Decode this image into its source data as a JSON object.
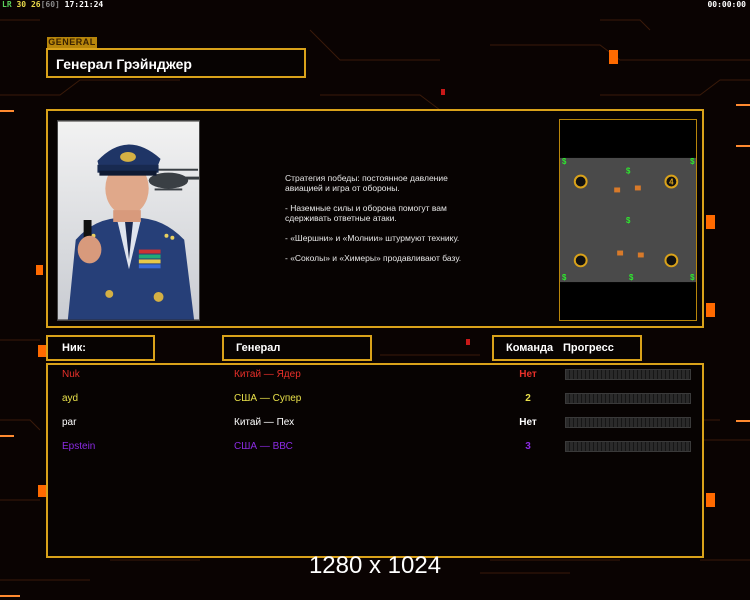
{
  "hud": {
    "fps_label": "LR",
    "fps_a": "30",
    "fps_b": "26",
    "fps_c": "[60]",
    "clock": "17:21:24",
    "game_timer": "00:00:00"
  },
  "general_tag": "GENERAL",
  "general_name": "Генерал Грэйнджер",
  "description": [
    "Стратегия победы: постоянное давление авиацией и игра от обороны.",
    "- Наземные силы и оборона помогут вам сдерживать ответные атаки.",
    "- «Шершни» и «Молнии» штурмуют технику.",
    "- «Соколы» и «Химеры» продавливают базу."
  ],
  "minimap": {
    "start_position_label": "4",
    "supply_symbol": "$"
  },
  "headers": {
    "nick": "Ник:",
    "general": "Генерал",
    "team": "Команда",
    "progress": "Прогресс"
  },
  "players": [
    {
      "nick": "Nuk",
      "general": "Китай — Ядер",
      "team": "Нет",
      "color": "#e8302a",
      "progress": 0
    },
    {
      "nick": "ayd",
      "general": "США — Супер",
      "team": "2",
      "color": "#e8e04a",
      "progress": 0
    },
    {
      "nick": "par",
      "general": "Китай — Пех",
      "team": "Нет",
      "color": "#ffffff",
      "progress": 0
    },
    {
      "nick": "Epstein",
      "general": "США — ВВС",
      "team": "3",
      "color": "#8a2be2",
      "progress": 0
    }
  ],
  "resolution": "1280 x 1024",
  "colors": {
    "frame": "#d9a21a",
    "hud_green": "#5bd05b",
    "hud_yellow": "#e8d84a",
    "accent_orange": "#ff6a00"
  }
}
